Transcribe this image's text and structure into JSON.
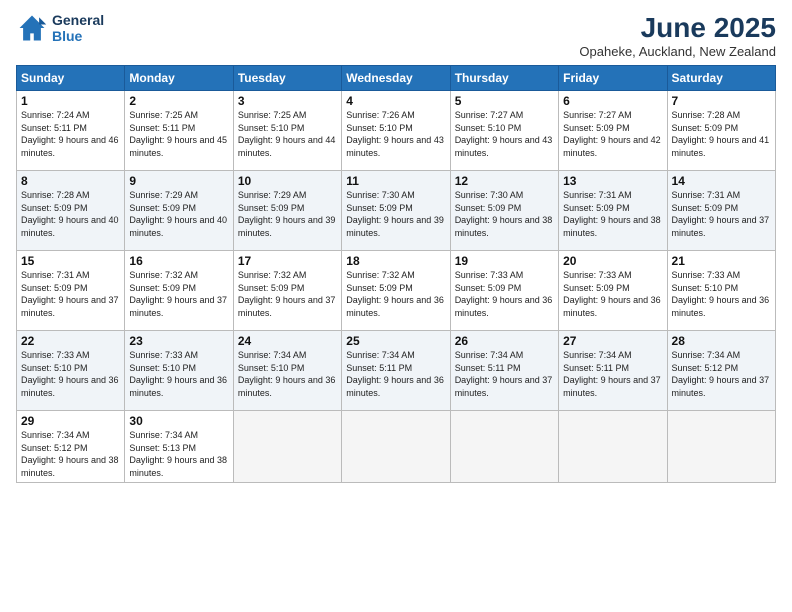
{
  "header": {
    "logo_line1": "General",
    "logo_line2": "Blue",
    "month_title": "June 2025",
    "location": "Opaheke, Auckland, New Zealand"
  },
  "weekdays": [
    "Sunday",
    "Monday",
    "Tuesday",
    "Wednesday",
    "Thursday",
    "Friday",
    "Saturday"
  ],
  "weeks": [
    [
      {
        "day": "1",
        "sunrise": "Sunrise: 7:24 AM",
        "sunset": "Sunset: 5:11 PM",
        "daylight": "Daylight: 9 hours and 46 minutes."
      },
      {
        "day": "2",
        "sunrise": "Sunrise: 7:25 AM",
        "sunset": "Sunset: 5:11 PM",
        "daylight": "Daylight: 9 hours and 45 minutes."
      },
      {
        "day": "3",
        "sunrise": "Sunrise: 7:25 AM",
        "sunset": "Sunset: 5:10 PM",
        "daylight": "Daylight: 9 hours and 44 minutes."
      },
      {
        "day": "4",
        "sunrise": "Sunrise: 7:26 AM",
        "sunset": "Sunset: 5:10 PM",
        "daylight": "Daylight: 9 hours and 43 minutes."
      },
      {
        "day": "5",
        "sunrise": "Sunrise: 7:27 AM",
        "sunset": "Sunset: 5:10 PM",
        "daylight": "Daylight: 9 hours and 43 minutes."
      },
      {
        "day": "6",
        "sunrise": "Sunrise: 7:27 AM",
        "sunset": "Sunset: 5:09 PM",
        "daylight": "Daylight: 9 hours and 42 minutes."
      },
      {
        "day": "7",
        "sunrise": "Sunrise: 7:28 AM",
        "sunset": "Sunset: 5:09 PM",
        "daylight": "Daylight: 9 hours and 41 minutes."
      }
    ],
    [
      {
        "day": "8",
        "sunrise": "Sunrise: 7:28 AM",
        "sunset": "Sunset: 5:09 PM",
        "daylight": "Daylight: 9 hours and 40 minutes."
      },
      {
        "day": "9",
        "sunrise": "Sunrise: 7:29 AM",
        "sunset": "Sunset: 5:09 PM",
        "daylight": "Daylight: 9 hours and 40 minutes."
      },
      {
        "day": "10",
        "sunrise": "Sunrise: 7:29 AM",
        "sunset": "Sunset: 5:09 PM",
        "daylight": "Daylight: 9 hours and 39 minutes."
      },
      {
        "day": "11",
        "sunrise": "Sunrise: 7:30 AM",
        "sunset": "Sunset: 5:09 PM",
        "daylight": "Daylight: 9 hours and 39 minutes."
      },
      {
        "day": "12",
        "sunrise": "Sunrise: 7:30 AM",
        "sunset": "Sunset: 5:09 PM",
        "daylight": "Daylight: 9 hours and 38 minutes."
      },
      {
        "day": "13",
        "sunrise": "Sunrise: 7:31 AM",
        "sunset": "Sunset: 5:09 PM",
        "daylight": "Daylight: 9 hours and 38 minutes."
      },
      {
        "day": "14",
        "sunrise": "Sunrise: 7:31 AM",
        "sunset": "Sunset: 5:09 PM",
        "daylight": "Daylight: 9 hours and 37 minutes."
      }
    ],
    [
      {
        "day": "15",
        "sunrise": "Sunrise: 7:31 AM",
        "sunset": "Sunset: 5:09 PM",
        "daylight": "Daylight: 9 hours and 37 minutes."
      },
      {
        "day": "16",
        "sunrise": "Sunrise: 7:32 AM",
        "sunset": "Sunset: 5:09 PM",
        "daylight": "Daylight: 9 hours and 37 minutes."
      },
      {
        "day": "17",
        "sunrise": "Sunrise: 7:32 AM",
        "sunset": "Sunset: 5:09 PM",
        "daylight": "Daylight: 9 hours and 37 minutes."
      },
      {
        "day": "18",
        "sunrise": "Sunrise: 7:32 AM",
        "sunset": "Sunset: 5:09 PM",
        "daylight": "Daylight: 9 hours and 36 minutes."
      },
      {
        "day": "19",
        "sunrise": "Sunrise: 7:33 AM",
        "sunset": "Sunset: 5:09 PM",
        "daylight": "Daylight: 9 hours and 36 minutes."
      },
      {
        "day": "20",
        "sunrise": "Sunrise: 7:33 AM",
        "sunset": "Sunset: 5:09 PM",
        "daylight": "Daylight: 9 hours and 36 minutes."
      },
      {
        "day": "21",
        "sunrise": "Sunrise: 7:33 AM",
        "sunset": "Sunset: 5:10 PM",
        "daylight": "Daylight: 9 hours and 36 minutes."
      }
    ],
    [
      {
        "day": "22",
        "sunrise": "Sunrise: 7:33 AM",
        "sunset": "Sunset: 5:10 PM",
        "daylight": "Daylight: 9 hours and 36 minutes."
      },
      {
        "day": "23",
        "sunrise": "Sunrise: 7:33 AM",
        "sunset": "Sunset: 5:10 PM",
        "daylight": "Daylight: 9 hours and 36 minutes."
      },
      {
        "day": "24",
        "sunrise": "Sunrise: 7:34 AM",
        "sunset": "Sunset: 5:10 PM",
        "daylight": "Daylight: 9 hours and 36 minutes."
      },
      {
        "day": "25",
        "sunrise": "Sunrise: 7:34 AM",
        "sunset": "Sunset: 5:11 PM",
        "daylight": "Daylight: 9 hours and 36 minutes."
      },
      {
        "day": "26",
        "sunrise": "Sunrise: 7:34 AM",
        "sunset": "Sunset: 5:11 PM",
        "daylight": "Daylight: 9 hours and 37 minutes."
      },
      {
        "day": "27",
        "sunrise": "Sunrise: 7:34 AM",
        "sunset": "Sunset: 5:11 PM",
        "daylight": "Daylight: 9 hours and 37 minutes."
      },
      {
        "day": "28",
        "sunrise": "Sunrise: 7:34 AM",
        "sunset": "Sunset: 5:12 PM",
        "daylight": "Daylight: 9 hours and 37 minutes."
      }
    ],
    [
      {
        "day": "29",
        "sunrise": "Sunrise: 7:34 AM",
        "sunset": "Sunset: 5:12 PM",
        "daylight": "Daylight: 9 hours and 38 minutes."
      },
      {
        "day": "30",
        "sunrise": "Sunrise: 7:34 AM",
        "sunset": "Sunset: 5:13 PM",
        "daylight": "Daylight: 9 hours and 38 minutes."
      },
      {
        "day": "",
        "sunrise": "",
        "sunset": "",
        "daylight": ""
      },
      {
        "day": "",
        "sunrise": "",
        "sunset": "",
        "daylight": ""
      },
      {
        "day": "",
        "sunrise": "",
        "sunset": "",
        "daylight": ""
      },
      {
        "day": "",
        "sunrise": "",
        "sunset": "",
        "daylight": ""
      },
      {
        "day": "",
        "sunrise": "",
        "sunset": "",
        "daylight": ""
      }
    ]
  ]
}
